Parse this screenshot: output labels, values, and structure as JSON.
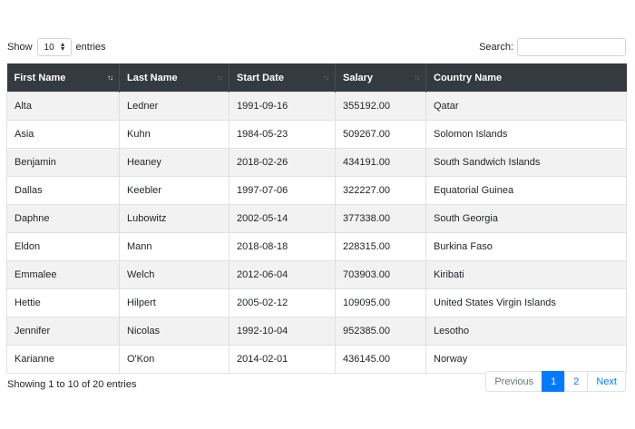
{
  "length": {
    "prefix": "Show",
    "value": "10",
    "suffix": "entries"
  },
  "search": {
    "label": "Search:",
    "value": ""
  },
  "table": {
    "headers": [
      "First Name",
      "Last Name",
      "Start Date",
      "Salary",
      "Country Name"
    ],
    "sort_indicator": "↑↓",
    "rows": [
      [
        "Alta",
        "Ledner",
        "1991-09-16",
        "355192.00",
        "Qatar"
      ],
      [
        "Asia",
        "Kuhn",
        "1984-05-23",
        "509267.00",
        "Solomon Islands"
      ],
      [
        "Benjamin",
        "Heaney",
        "2018-02-26",
        "434191.00",
        "South Sandwich Islands"
      ],
      [
        "Dallas",
        "Keebler",
        "1997-07-06",
        "322227.00",
        "Equatorial Guinea"
      ],
      [
        "Daphne",
        "Lubowitz",
        "2002-05-14",
        "377338.00",
        "South Georgia"
      ],
      [
        "Eldon",
        "Mann",
        "2018-08-18",
        "228315.00",
        "Burkina Faso"
      ],
      [
        "Emmalee",
        "Welch",
        "2012-06-04",
        "703903.00",
        "Kiribati"
      ],
      [
        "Hettie",
        "Hilpert",
        "2005-02-12",
        "109095.00",
        "United States Virgin Islands"
      ],
      [
        "Jennifer",
        "Nicolas",
        "1992-10-04",
        "952385.00",
        "Lesotho"
      ],
      [
        "Karianne",
        "O'Kon",
        "2014-02-01",
        "436145.00",
        "Norway"
      ]
    ]
  },
  "info": "Showing 1 to 10 of 20 entries",
  "pagination": {
    "previous": "Previous",
    "pages": [
      "1",
      "2"
    ],
    "next": "Next",
    "current": "1"
  },
  "colors": {
    "header_bg": "#343a40",
    "accent": "#007bff",
    "stripe": "#f2f2f2"
  }
}
